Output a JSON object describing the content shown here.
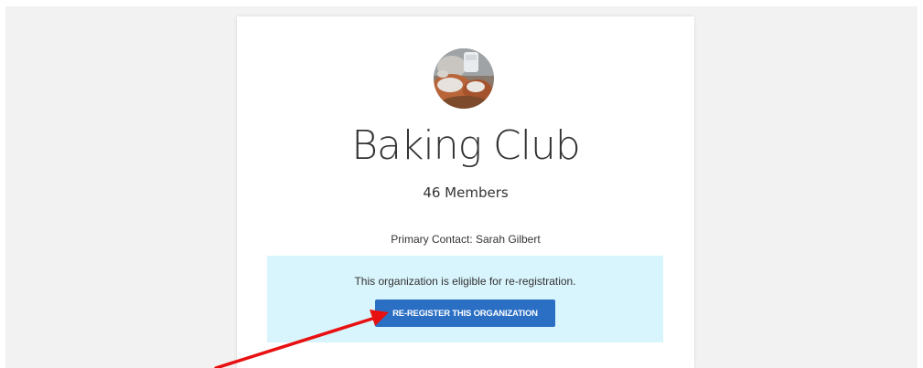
{
  "organization": {
    "avatar_icon": "baked-goods-photo",
    "name": "Baking Club",
    "member_count": "46 Members",
    "primary_contact": "Primary Contact: Sarah Gilbert"
  },
  "eligibility": {
    "message": "This organization is eligible for re-registration.",
    "button_label": "RE-REGISTER THIS ORGANIZATION"
  },
  "annotation": {
    "arrow_color": "#e81010"
  },
  "colors": {
    "accent": "#2a6fc4",
    "info_background": "#d8f4fc",
    "page_background": "#f2f2f2"
  }
}
